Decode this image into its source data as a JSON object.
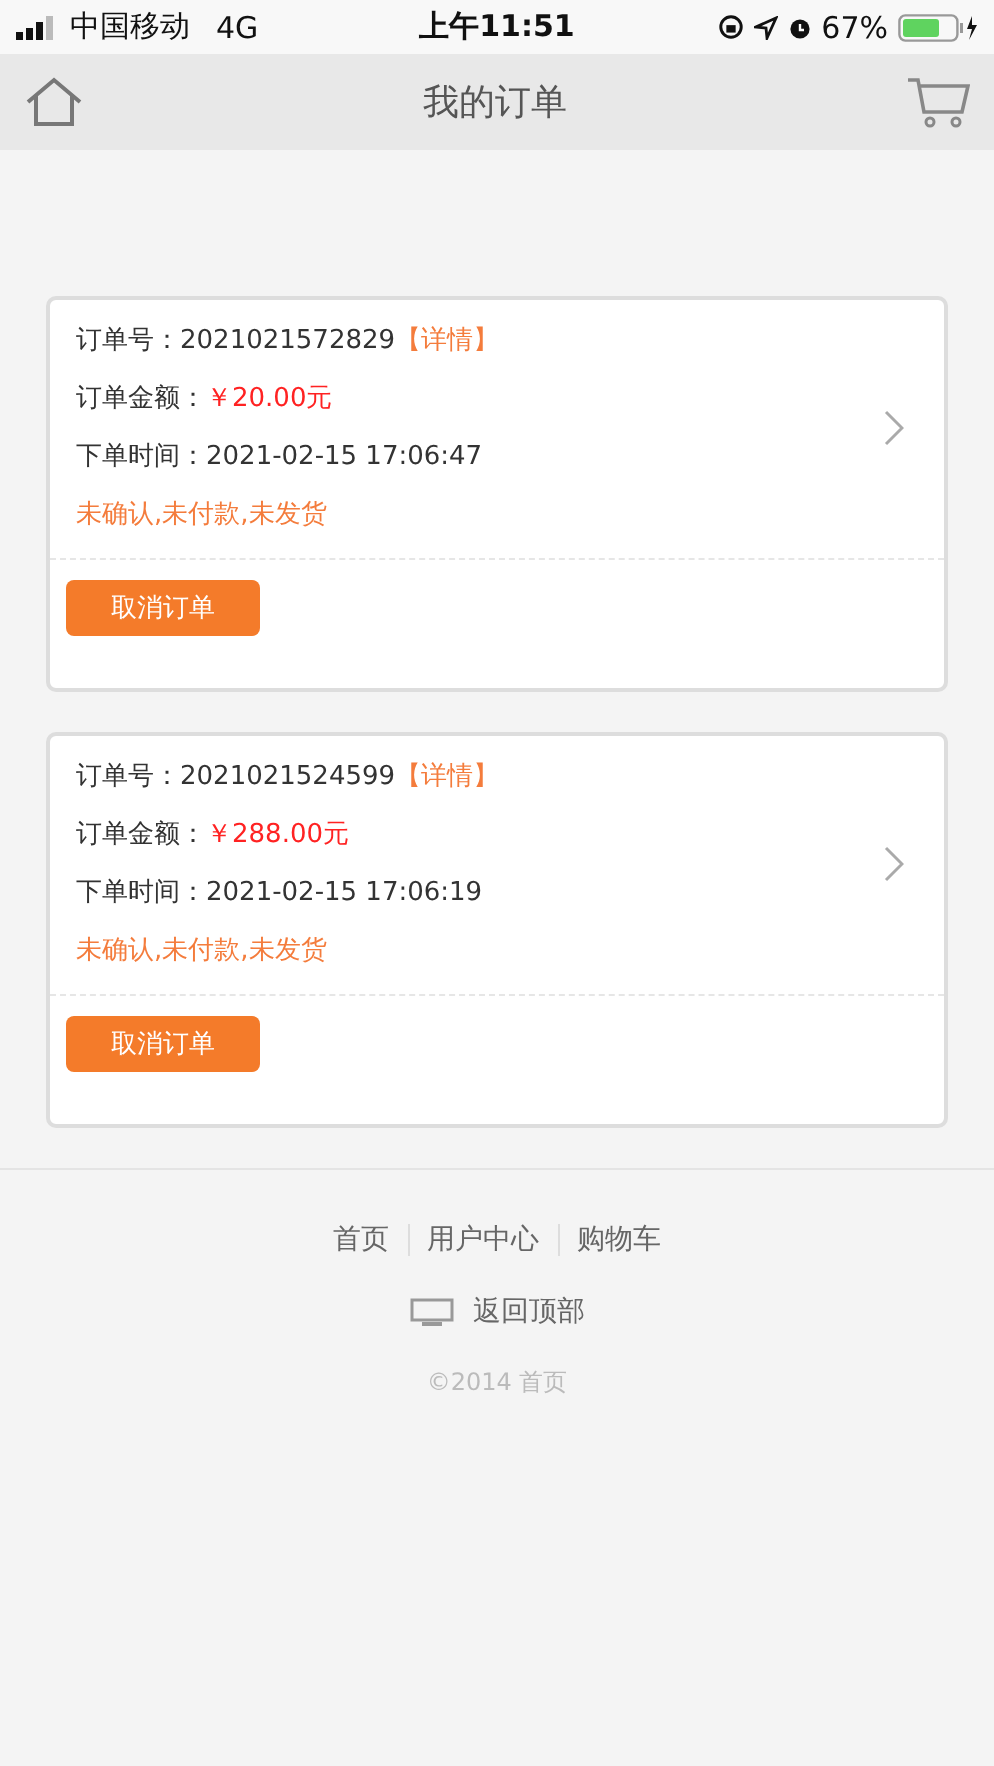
{
  "status_bar": {
    "carrier": "中国移动",
    "network": "4G",
    "time": "上午11:51",
    "battery_percent": "67%"
  },
  "header": {
    "title": "我的订单"
  },
  "orders": [
    {
      "number_label": "订单号：2021021572829",
      "detail_link": "【详情】",
      "amount_label": "订单金额：",
      "amount": "￥20.00元",
      "time": "下单时间：2021-02-15 17:06:47",
      "status": "未确认,未付款,未发货",
      "cancel_button": "取消订单"
    },
    {
      "number_label": "订单号：2021021524599",
      "detail_link": "【详情】",
      "amount_label": "订单金额：",
      "amount": "￥288.00元",
      "time": "下单时间：2021-02-15 17:06:19",
      "status": "未确认,未付款,未发货",
      "cancel_button": "取消订单"
    }
  ],
  "footer": {
    "links": [
      "首页",
      "用户中心",
      "购物车"
    ],
    "back_to_top": "返回顶部",
    "copyright": "©2014 首页"
  }
}
